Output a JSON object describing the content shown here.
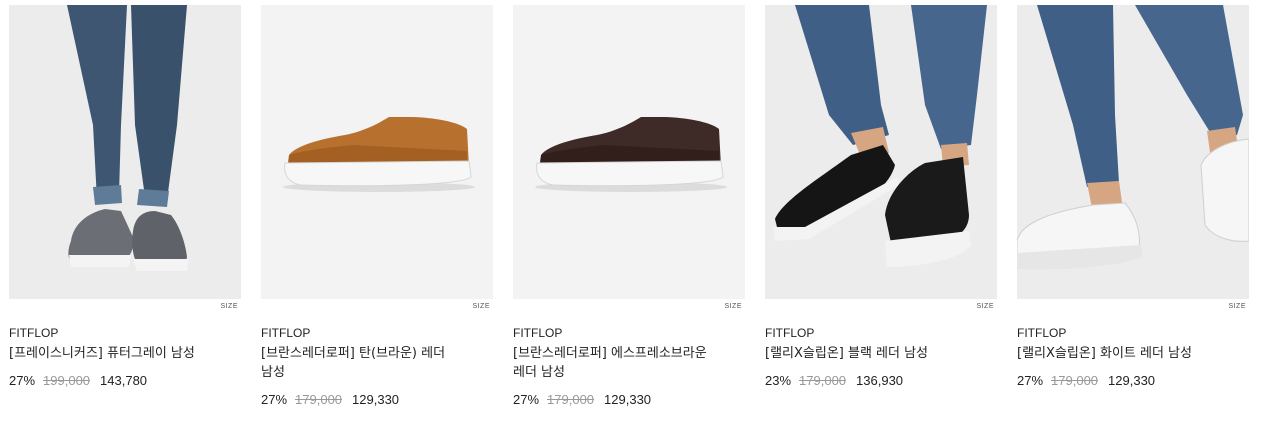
{
  "products": [
    {
      "brand": "FITFLOP",
      "name": "[프레이스니커즈] 퓨터그레이 남성",
      "discount": "27%",
      "original_price": "199,000",
      "sale_price": "143,780",
      "size_label": "SIZE",
      "image_icon": "grey-sneaker-model-photo"
    },
    {
      "brand": "FITFLOP",
      "name": "[브란스레더로퍼] 탄(브라운) 레더 남성",
      "discount": "27%",
      "original_price": "179,000",
      "sale_price": "129,330",
      "size_label": "SIZE",
      "image_icon": "tan-loafer-photo"
    },
    {
      "brand": "FITFLOP",
      "name": "[브란스레더로퍼] 에스프레소브라운 레더 남성",
      "discount": "27%",
      "original_price": "179,000",
      "sale_price": "129,330",
      "size_label": "SIZE",
      "image_icon": "espresso-loafer-photo"
    },
    {
      "brand": "FITFLOP",
      "name": "[랠리X슬립온] 블랙 레더 남성",
      "discount": "23%",
      "original_price": "179,000",
      "sale_price": "136,930",
      "size_label": "SIZE",
      "image_icon": "black-slipon-model-photo"
    },
    {
      "brand": "FITFLOP",
      "name": "[랠리X슬립온] 화이트 레더 남성",
      "discount": "27%",
      "original_price": "179,000",
      "sale_price": "129,330",
      "size_label": "SIZE",
      "image_icon": "white-slipon-model-photo"
    }
  ]
}
